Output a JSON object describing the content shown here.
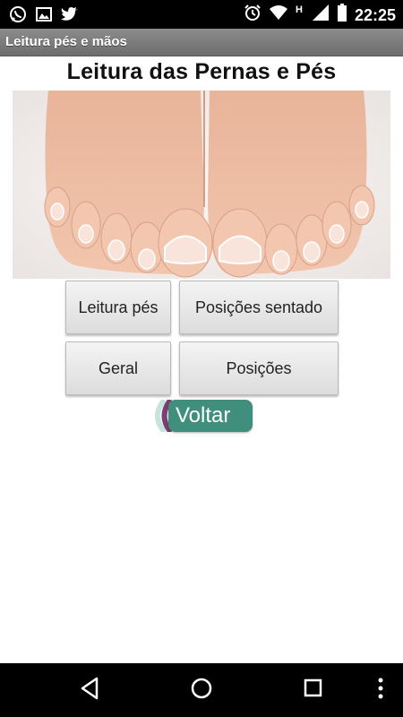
{
  "status_bar": {
    "time": "22:25",
    "left_icons": [
      "whatsapp-icon",
      "image-icon",
      "twitter-icon"
    ],
    "right_icons": [
      "alarm-icon",
      "wifi-icon",
      "signal-h-icon",
      "signal-icon",
      "battery-icon"
    ],
    "network_label": "H"
  },
  "title_bar": {
    "title": "Leitura pés e mãos"
  },
  "content": {
    "heading": "Leitura das Pernas e Pés",
    "image": "feet-photo",
    "buttons": [
      {
        "label": "Leitura pés"
      },
      {
        "label": "Posições sentado"
      },
      {
        "label": "Geral"
      },
      {
        "label": "Posições"
      }
    ],
    "back_button": {
      "label": "Voltar"
    },
    "colors": {
      "back_button": "#3f8f7c",
      "back_arc_dark": "#7b3f74",
      "back_arc_light": "#c7e3dc"
    }
  },
  "nav_bar": {
    "icons": [
      "back-icon",
      "home-icon",
      "recents-icon",
      "menu-icon"
    ]
  }
}
